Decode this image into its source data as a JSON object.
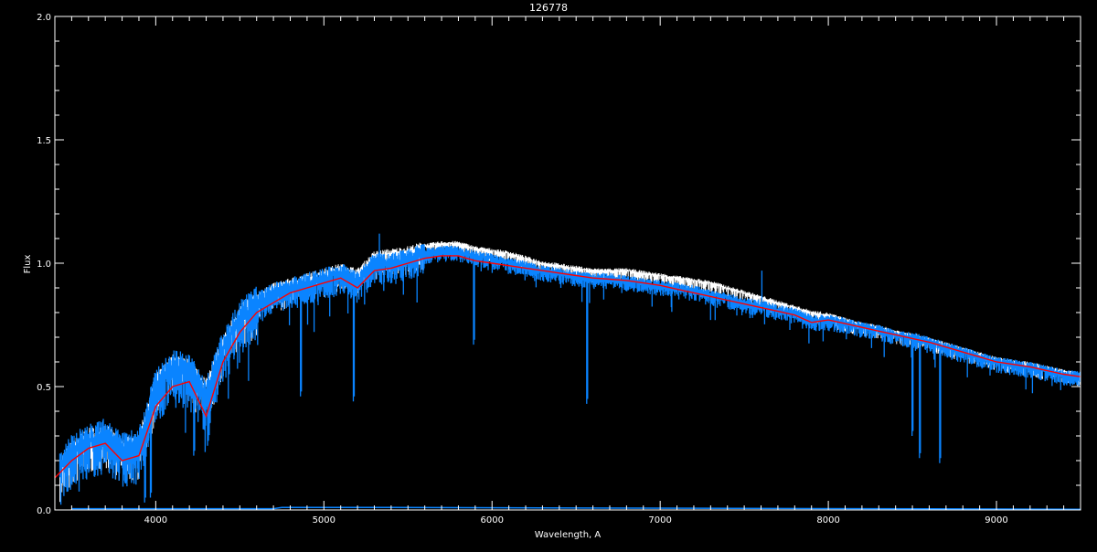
{
  "chart_data": {
    "type": "line",
    "title": "126778",
    "xlabel": "Wavelength, A",
    "ylabel": "Flux",
    "xlim": [
      3400,
      9500
    ],
    "ylim": [
      0.0,
      2.0
    ],
    "x_ticks": [
      "4000",
      "5000",
      "6000",
      "7000",
      "8000",
      "9000"
    ],
    "y_ticks": [
      "0.0",
      "0.5",
      "1.0",
      "1.5",
      "2.0"
    ],
    "grid": false,
    "colors": {
      "background": "#000000",
      "axes": "#ffffff",
      "observed": "#0a84ff",
      "observed_upper": "#ffffff",
      "model": "#ff0000"
    },
    "x": [
      3400,
      3500,
      3600,
      3700,
      3800,
      3900,
      4000,
      4100,
      4200,
      4300,
      4400,
      4500,
      4600,
      4700,
      4800,
      4900,
      5000,
      5100,
      5200,
      5300,
      5400,
      5500,
      5600,
      5700,
      5800,
      5900,
      6000,
      6100,
      6200,
      6300,
      6400,
      6500,
      6600,
      6700,
      6800,
      6900,
      7000,
      7100,
      7200,
      7300,
      7400,
      7500,
      7600,
      7700,
      7800,
      7900,
      8000,
      8100,
      8200,
      8300,
      8400,
      8500,
      8600,
      8700,
      8800,
      8900,
      9000,
      9100,
      9200,
      9300,
      9400,
      9500
    ],
    "series": [
      {
        "role": "white-spectrum",
        "values": [
          0.15,
          0.25,
          0.3,
          0.32,
          0.26,
          0.28,
          0.52,
          0.6,
          0.58,
          0.5,
          0.68,
          0.8,
          0.86,
          0.9,
          0.92,
          0.94,
          0.96,
          0.98,
          0.96,
          1.03,
          1.04,
          1.05,
          1.07,
          1.08,
          1.08,
          1.06,
          1.05,
          1.04,
          1.02,
          1.0,
          0.99,
          0.98,
          0.97,
          0.97,
          0.97,
          0.96,
          0.95,
          0.94,
          0.93,
          0.92,
          0.9,
          0.88,
          0.86,
          0.84,
          0.82,
          0.8,
          0.79,
          0.77,
          0.75,
          0.74,
          0.72,
          0.71,
          0.69,
          0.67,
          0.65,
          0.63,
          0.61,
          0.6,
          0.59,
          0.575,
          0.56,
          0.55
        ]
      },
      {
        "role": "blue-spectrum",
        "values": [
          0.14,
          0.24,
          0.28,
          0.3,
          0.24,
          0.26,
          0.5,
          0.58,
          0.56,
          0.46,
          0.66,
          0.78,
          0.84,
          0.88,
          0.9,
          0.92,
          0.94,
          0.96,
          0.93,
          1.0,
          1.0,
          1.02,
          1.04,
          1.05,
          1.05,
          1.03,
          1.02,
          1.0,
          0.99,
          0.97,
          0.96,
          0.95,
          0.94,
          0.94,
          0.93,
          0.92,
          0.91,
          0.9,
          0.89,
          0.87,
          0.86,
          0.84,
          0.83,
          0.81,
          0.8,
          0.77,
          0.77,
          0.76,
          0.74,
          0.73,
          0.71,
          0.7,
          0.68,
          0.66,
          0.64,
          0.62,
          0.6,
          0.59,
          0.58,
          0.565,
          0.55,
          0.54
        ]
      },
      {
        "role": "red-model",
        "values": [
          0.13,
          0.2,
          0.25,
          0.27,
          0.2,
          0.22,
          0.42,
          0.5,
          0.52,
          0.38,
          0.6,
          0.72,
          0.8,
          0.84,
          0.88,
          0.9,
          0.92,
          0.94,
          0.9,
          0.97,
          0.98,
          1.0,
          1.02,
          1.03,
          1.03,
          1.01,
          1.0,
          0.99,
          0.98,
          0.97,
          0.96,
          0.95,
          0.94,
          0.935,
          0.93,
          0.92,
          0.91,
          0.895,
          0.88,
          0.865,
          0.85,
          0.835,
          0.82,
          0.805,
          0.79,
          0.76,
          0.77,
          0.755,
          0.74,
          0.725,
          0.71,
          0.695,
          0.68,
          0.66,
          0.64,
          0.62,
          0.6,
          0.59,
          0.58,
          0.565,
          0.55,
          0.54
        ]
      }
    ],
    "absorption_lines": [
      {
        "x": 3934,
        "y": 0.03
      },
      {
        "x": 3968,
        "y": 0.05
      },
      {
        "x": 4226,
        "y": 0.22
      },
      {
        "x": 4308,
        "y": 0.26
      },
      {
        "x": 4861,
        "y": 0.46
      },
      {
        "x": 5175,
        "y": 0.44
      },
      {
        "x": 5890,
        "y": 0.67
      },
      {
        "x": 6563,
        "y": 0.43
      },
      {
        "x": 8498,
        "y": 0.3
      },
      {
        "x": 8542,
        "y": 0.21
      },
      {
        "x": 8662,
        "y": 0.19
      }
    ],
    "emission_lines": [
      {
        "x": 7605,
        "y": 0.97
      },
      {
        "x": 5330,
        "y": 1.12
      }
    ],
    "error_spectrum": {
      "x": [
        3500,
        4700,
        4750,
        5400,
        9500
      ],
      "values": [
        0.005,
        0.005,
        0.01,
        0.01,
        0.003
      ]
    }
  }
}
